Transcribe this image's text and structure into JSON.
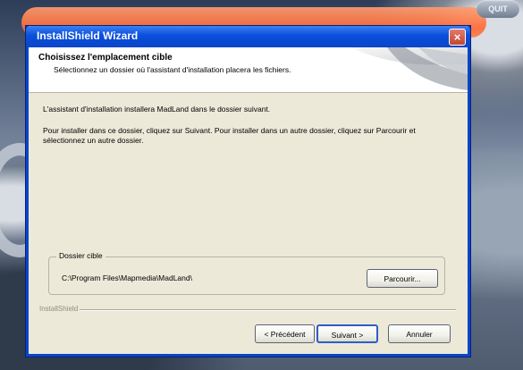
{
  "window": {
    "title": "InstallShield Wizard",
    "close_label": "×"
  },
  "corner_button": {
    "label": "QUIT"
  },
  "header": {
    "title": "Choisissez l'emplacement cible",
    "description": "Sélectionnez un dossier où l'assistant d'installation placera les fichiers."
  },
  "body": {
    "line1": "L'assistant d'installation installera MadLand dans le dossier suivant.",
    "line2": "Pour installer dans ce dossier, cliquez sur Suivant. Pour installer dans un autre dossier, cliquez sur Parcourir et sélectionnez un autre dossier."
  },
  "destination": {
    "group_label": "Dossier cible",
    "path": "C:\\Program Files\\Mapmedia\\MadLand\\",
    "browse_label": "Parcourir..."
  },
  "footer": {
    "brand": "InstallShield",
    "prev_label": "< Précédent",
    "next_label": "Suivant >",
    "cancel_label": "Annuler"
  },
  "colors": {
    "title_bar": "#0a45c8",
    "window_bg": "#ece9d8",
    "close_button": "#c2472f"
  }
}
